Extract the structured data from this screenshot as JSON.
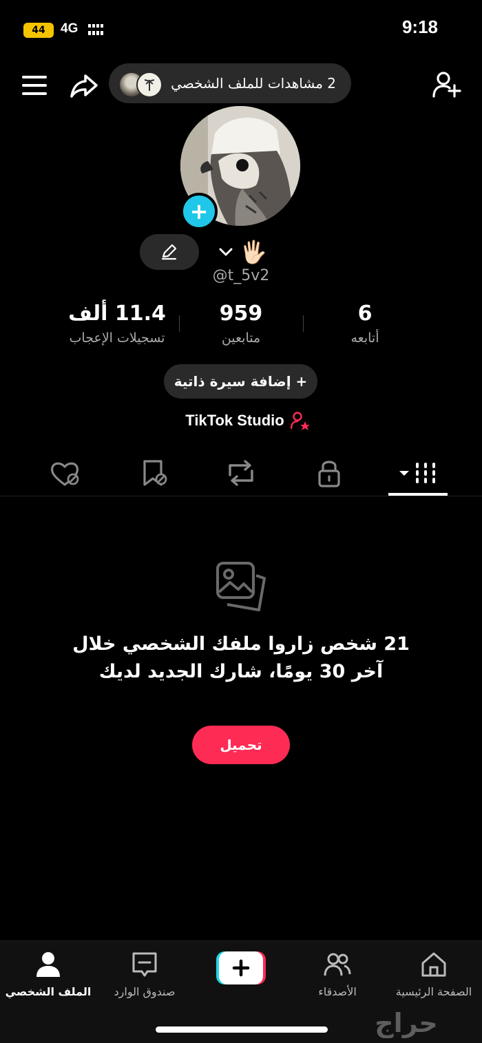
{
  "status_bar": {
    "time": "9:18",
    "network": "4G",
    "battery": "44"
  },
  "header": {
    "profile_views": "2 مشاهدات للملف الشخصي"
  },
  "profile": {
    "handle": "@t_5v2",
    "emoji": "🖐🏻"
  },
  "stats": [
    {
      "value": "6",
      "label": "أتابعه"
    },
    {
      "value": "959",
      "label": "متابعين"
    },
    {
      "value": "11.4 ألف",
      "label": "تسجيلات الإعجاب"
    }
  ],
  "bio_button": "+ إضافة سيرة ذاتية",
  "studio_label": "TikTok Studio",
  "tabs": [
    "videos-grid-icon",
    "lock-icon",
    "repost-icon",
    "bookmark-icon",
    "liked-icon"
  ],
  "empty_state": {
    "message": "21 شخص زاروا ملفك الشخصي خلال آخر 30 يومًا، شارك الجديد لديك",
    "upload_button": "تحميل"
  },
  "bottom_nav": {
    "home": "الصفحة الرئيسية",
    "friends": "الأصدقاء",
    "inbox": "صندوق الوارد",
    "profile": "الملف الشخصي"
  },
  "watermark": "حراج",
  "colors": {
    "accent": "#fe2c55",
    "cyan": "#20c7e8",
    "background": "#000000"
  }
}
